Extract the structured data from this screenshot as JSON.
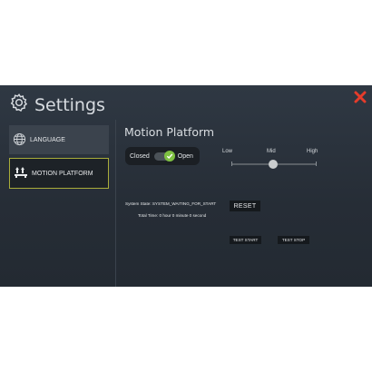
{
  "settings": {
    "title": "Settings"
  },
  "sidebar": {
    "items": [
      {
        "label": "LANGUAGE",
        "icon": "globe-icon"
      },
      {
        "label": "MOTION PLATFORM",
        "icon": "motion-platform-icon"
      }
    ]
  },
  "main": {
    "title": "Motion Platform",
    "door_toggle": {
      "left_label": "Closed",
      "right_label": "Open",
      "state": "open"
    },
    "intensity_slider": {
      "low": "Low",
      "mid": "Mid",
      "high": "High",
      "value": "Mid"
    },
    "system_state": "System State: SYSTEM_WAITING_FOR_START",
    "total_time": "Total Time: 0 hour 0 minute 0 second",
    "buttons": {
      "reset": "RESET",
      "test_start": "TEST START",
      "test_stop": "TEST STOP"
    }
  },
  "colors": {
    "close": "#e53c2b",
    "accent_green": "#7fc142",
    "active_border": "#a9ad3a"
  }
}
